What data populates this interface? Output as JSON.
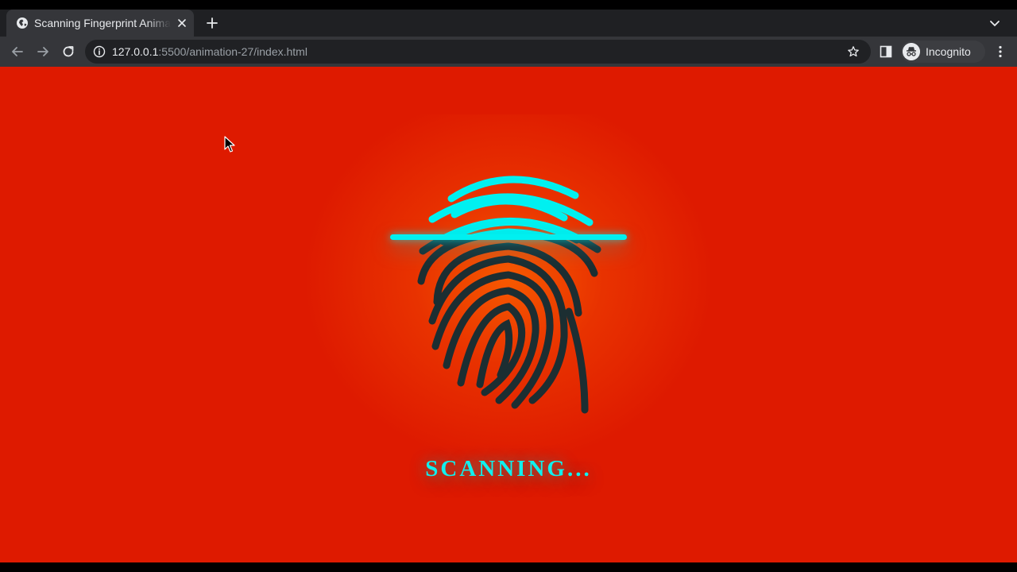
{
  "browser": {
    "tab": {
      "title": "Scanning Fingerprint Animation",
      "favicon": "globe-icon",
      "close": "close-icon"
    },
    "url": {
      "host": "127.0.0.1",
      "path": ":5500/animation-27/index.html"
    },
    "profile": {
      "label": "Incognito",
      "icon": "incognito-icon"
    }
  },
  "page": {
    "status_text": "SCANNING...",
    "colors": {
      "background": "#de1a00",
      "scan_beam": "#00f0f0",
      "fingerprint_scanned": "#00f0f0",
      "fingerprint_unscanned": "#1c2e32",
      "glow": "#ff6e00"
    }
  }
}
